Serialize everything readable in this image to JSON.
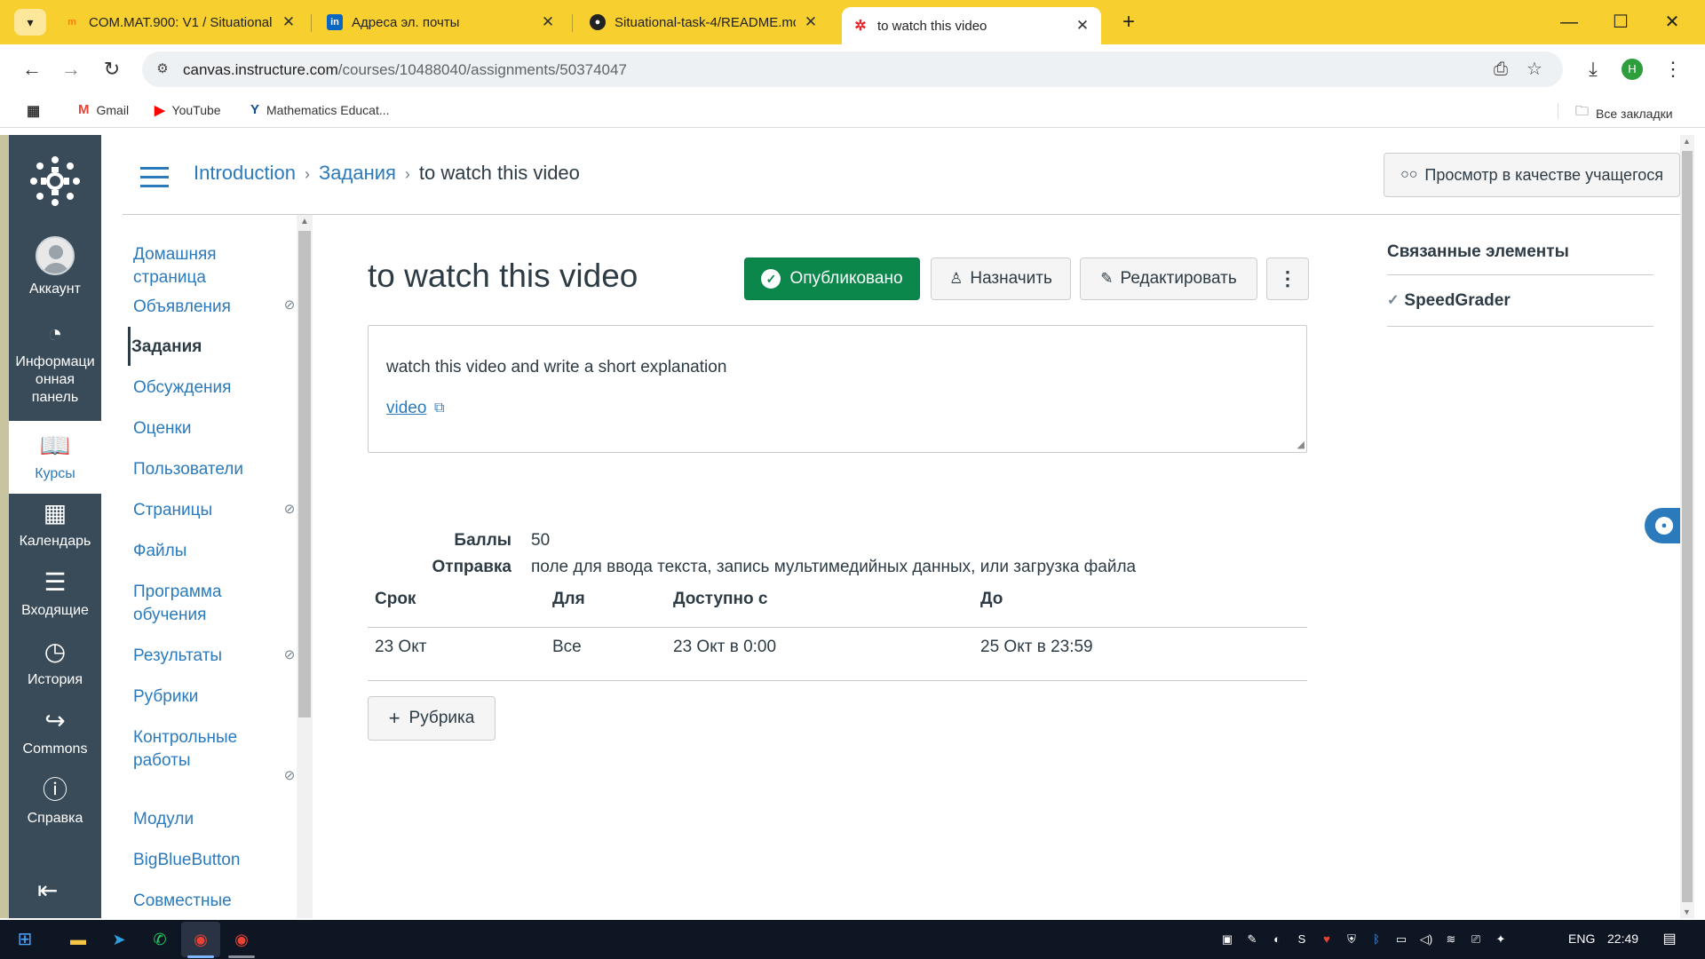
{
  "browser": {
    "tabs": [
      {
        "title": "COM.MAT.900: V1 / Situational",
        "icon": "moodle-icon",
        "active": false
      },
      {
        "title": "Адреса эл. почты",
        "icon": "linkedin-icon",
        "active": false
      },
      {
        "title": "Situational-task-4/README.md",
        "icon": "github-icon",
        "active": false
      },
      {
        "title": "to watch this video",
        "icon": "canvas-icon",
        "active": true
      }
    ],
    "url_host": "canvas.instructure.com",
    "url_path": "/courses/10488040/assignments/50374047",
    "profile_initial": "H",
    "bookmarks": [
      {
        "label": "Gmail",
        "icon": "gmail-icon"
      },
      {
        "label": "YouTube",
        "icon": "youtube-icon"
      },
      {
        "label": "Mathematics Educat...",
        "icon": "yale-icon"
      }
    ],
    "all_bookmarks": "Все закладки"
  },
  "global_nav": {
    "items": [
      {
        "label": "Аккаунт",
        "icon": "account-icon"
      },
      {
        "label": "Информационная панель",
        "label_lines": [
          "Информаци",
          "онная",
          "панель"
        ],
        "icon": "dashboard-icon"
      },
      {
        "label": "Курсы",
        "icon": "courses-icon",
        "active": true
      },
      {
        "label": "Календарь",
        "icon": "calendar-icon"
      },
      {
        "label": "Входящие",
        "icon": "inbox-icon"
      },
      {
        "label": "История",
        "icon": "history-icon"
      },
      {
        "label": "Commons",
        "icon": "commons-icon"
      },
      {
        "label": "Справка",
        "icon": "help-icon"
      }
    ]
  },
  "breadcrumb": {
    "course": "Introduction",
    "section": "Задания",
    "current": "to watch this video"
  },
  "student_view_label": "Просмотр в качестве учащегося",
  "course_nav": {
    "items": [
      {
        "label": "Домашняя страница",
        "hidden": false
      },
      {
        "label": "Объявления",
        "hidden": true
      },
      {
        "label": "Задания",
        "hidden": false,
        "active": true
      },
      {
        "label": "Обсуждения",
        "hidden": false
      },
      {
        "label": "Оценки",
        "hidden": false
      },
      {
        "label": "Пользователи",
        "hidden": false
      },
      {
        "label": "Страницы",
        "hidden": true
      },
      {
        "label": "Файлы",
        "hidden": false
      },
      {
        "label": "Программа обучения",
        "hidden": false
      },
      {
        "label": "Результаты",
        "hidden": true
      },
      {
        "label": "Рубрики",
        "hidden": false
      },
      {
        "label": "Контрольные работы",
        "hidden": true
      },
      {
        "label": "Модули",
        "hidden": false
      },
      {
        "label": "BigBlueButton",
        "hidden": false
      },
      {
        "label": "Совместные",
        "hidden": false
      }
    ]
  },
  "assignment": {
    "title": "to watch this video",
    "published_label": "Опубликовано",
    "assign_label": "Назначить",
    "edit_label": "Редактировать",
    "description_text": "watch this video and write a short explanation",
    "description_link": "video",
    "points_label": "Баллы",
    "points_value": "50",
    "submission_label": "Отправка",
    "submission_value": "поле для ввода текста, запись мультимедийных данных, или загрузка файла",
    "due_table": {
      "headers": [
        "Срок",
        "Для",
        "Доступно с",
        "До"
      ],
      "row": [
        "23 Окт",
        "Все",
        "23 Окт в 0:00",
        "25 Окт в 23:59"
      ]
    },
    "rubric_label": "Рубрика"
  },
  "related": {
    "title": "Связанные элементы",
    "items": [
      {
        "label": "SpeedGrader",
        "icon": "speedgrader-icon"
      }
    ]
  },
  "taskbar": {
    "lang": "ENG",
    "time": "22:49"
  },
  "colors": {
    "chrome_yellow": "#f7cf2e",
    "canvas_nav": "#394b58",
    "link_blue": "#2b7abc",
    "published_green": "#0b874b"
  }
}
